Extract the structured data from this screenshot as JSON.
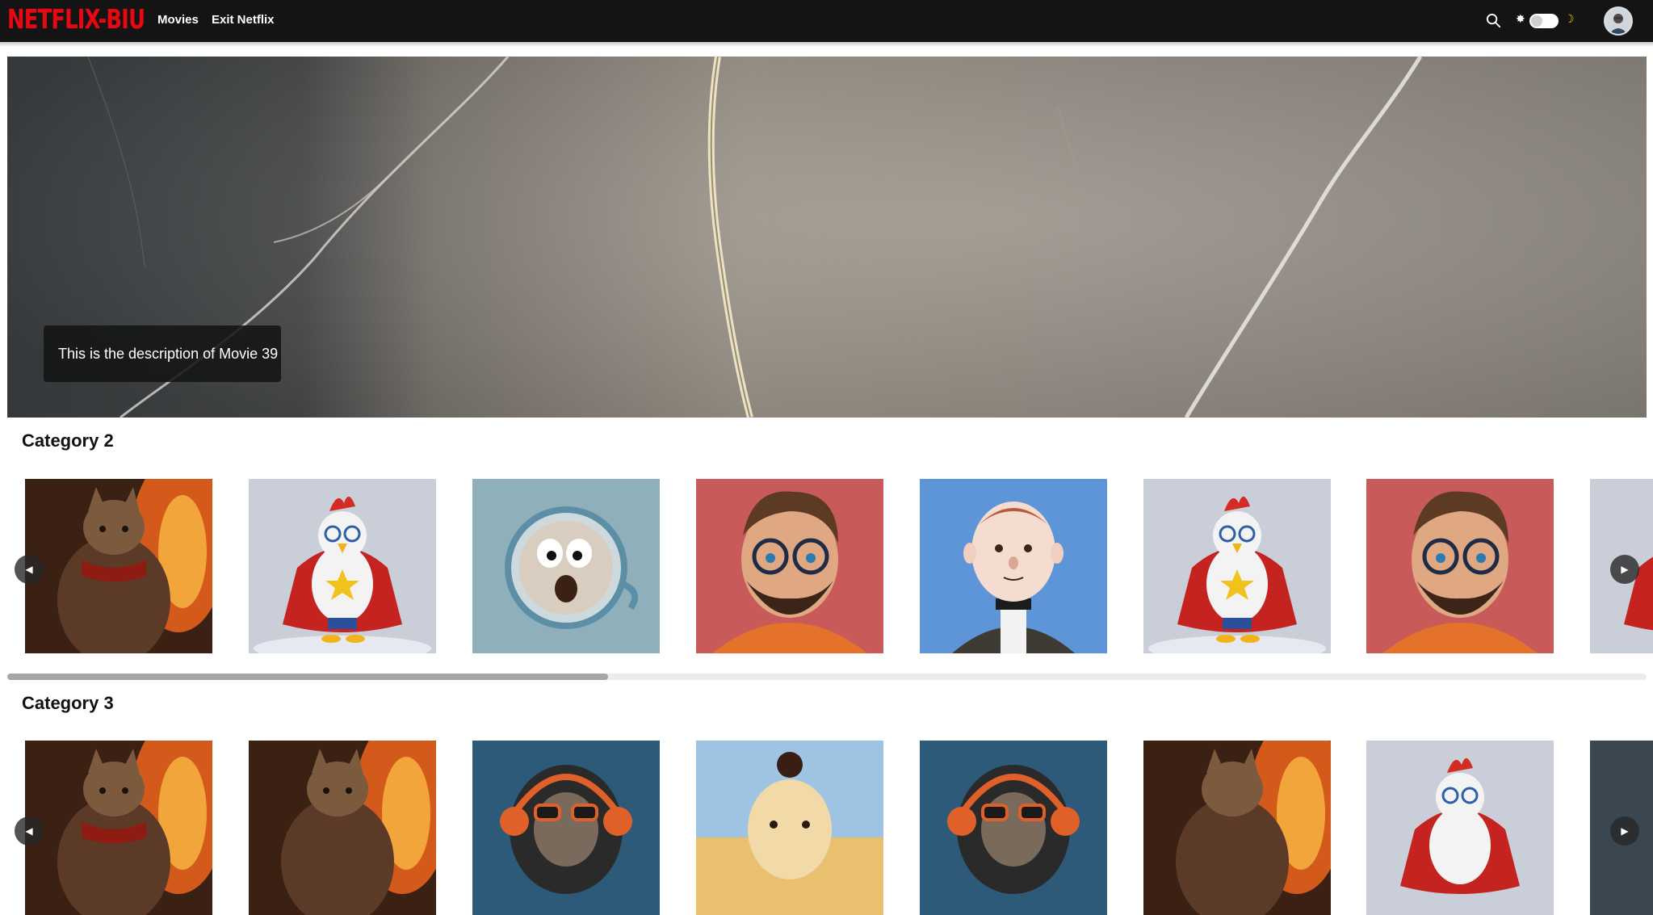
{
  "nav": {
    "logo": "NETFLIX-BIU",
    "links": [
      "Movies",
      "Exit Netflix"
    ],
    "icons": {
      "search": "search-icon",
      "sun": "sun-icon",
      "moon": "moon-icon",
      "avatar": "user-avatar"
    },
    "theme_toggle_on": false
  },
  "hero": {
    "description": "This is the description of Movie 39"
  },
  "categories": [
    {
      "title": "Category 2",
      "cards": [
        "cat-samurai-poster",
        "rooster-superhero-poster",
        "coffee-face-poster",
        "bearded-man-poster",
        "bald-cartoon-man-poster",
        "rooster-superhero-poster",
        "bearded-man-poster",
        "rooster-superhero-poster"
      ]
    },
    {
      "title": "Category 3",
      "cards": [
        "cat-samurai-poster",
        "cat-samurai-poster",
        "monkey-headphones-poster",
        "topknot-man-poster",
        "monkey-headphones-poster",
        "cat-samurai-poster",
        "rooster-superhero-poster",
        "dark-poster"
      ]
    }
  ],
  "carousel": {
    "prev_icon": "arrow-left-icon",
    "next_icon": "arrow-right-icon"
  },
  "colors": {
    "brand": "#e50914",
    "nav_bg": "#141414",
    "accent": "#f5c518"
  }
}
